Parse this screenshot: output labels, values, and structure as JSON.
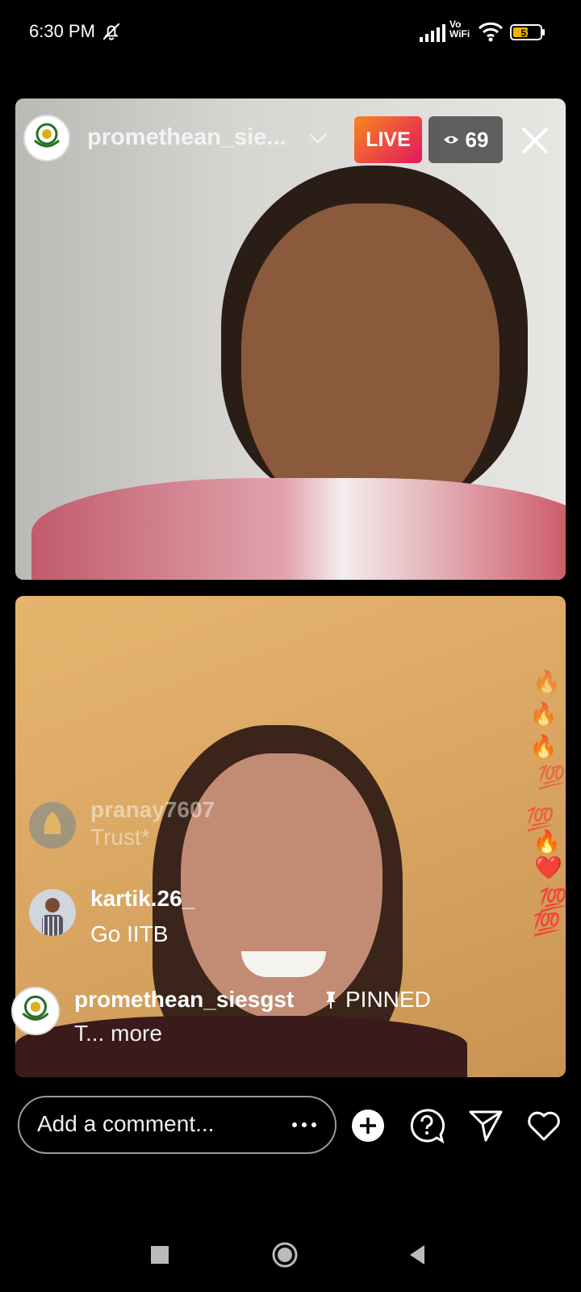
{
  "status_bar": {
    "time": "6:30 PM",
    "vowifi_top": "Vo",
    "vowifi_bottom": "WiFi",
    "battery": "51"
  },
  "live": {
    "host_name": "promethean_sie...",
    "live_label": "LIVE",
    "viewer_count": "69"
  },
  "comments": [
    {
      "user": "pranay7607",
      "text": "Trust*",
      "faded": true
    },
    {
      "user": "kartik.26_",
      "text": "Go IITB",
      "faded": false
    }
  ],
  "pinned": {
    "user": "promethean_siesgst",
    "label": "PINNED",
    "text": "T... more"
  },
  "reactions": [
    "🔥",
    "🔥",
    "🔥",
    "💯",
    "💯",
    "🔥",
    "❤️",
    "💯",
    "💯"
  ],
  "bottom_bar": {
    "placeholder": "Add a comment..."
  },
  "colors": {
    "live_gradient_start": "#f5871f",
    "live_gradient_end": "#e5155f"
  }
}
